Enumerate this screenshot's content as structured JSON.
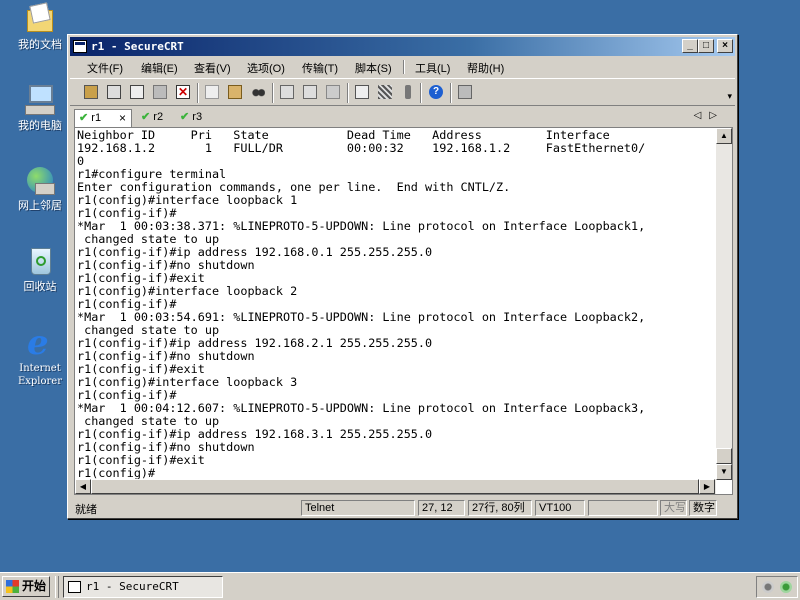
{
  "desktop": {
    "icons": [
      {
        "label": "我的文档",
        "icon": "my-documents-icon"
      },
      {
        "label": "我的电脑",
        "icon": "my-computer-icon"
      },
      {
        "label": "网上邻居",
        "icon": "network-places-icon"
      },
      {
        "label": "回收站",
        "icon": "recycle-bin-icon"
      },
      {
        "label": "Internet Explorer",
        "icon": "internet-explorer-icon"
      }
    ]
  },
  "window": {
    "title": "r1 - SecureCRT",
    "controls": {
      "minimize": "_",
      "maximize": "□",
      "close": "×"
    },
    "menu": [
      "文件(F)",
      "编辑(E)",
      "查看(V)",
      "选项(O)",
      "传输(T)",
      "脚本(S)",
      "工具(L)",
      "帮助(H)"
    ],
    "toolbar_icons": [
      "connect-icon",
      "quick-connect-icon",
      "connect-tab-icon",
      "reconnect-icon",
      "disconnect-icon",
      "copy-icon",
      "paste-icon",
      "find-icon",
      "print-setup-icon",
      "print-icon",
      "print-selection-icon",
      "session-options-icon",
      "global-options-icon",
      "keymap-icon",
      "help-icon",
      "about-icon"
    ],
    "tabs": [
      {
        "label": "r1",
        "active": true,
        "close": "×"
      },
      {
        "label": "r2",
        "active": false
      },
      {
        "label": "r3",
        "active": false
      }
    ],
    "tab_arrows": "◁▷",
    "terminal_lines": [
      "Neighbor ID     Pri   State           Dead Time   Address         Interface",
      "192.168.1.2       1   FULL/DR         00:00:32    192.168.1.2     FastEthernet0/",
      "0",
      "r1#configure terminal",
      "Enter configuration commands, one per line.  End with CNTL/Z.",
      "r1(config)#interface loopback 1",
      "r1(config-if)#",
      "*Mar  1 00:03:38.371: %LINEPROTO-5-UPDOWN: Line protocol on Interface Loopback1,",
      " changed state to up",
      "r1(config-if)#ip address 192.168.0.1 255.255.255.0",
      "r1(config-if)#no shutdown",
      "r1(config-if)#exit",
      "r1(config)#interface loopback 2",
      "r1(config-if)#",
      "*Mar  1 00:03:54.691: %LINEPROTO-5-UPDOWN: Line protocol on Interface Loopback2,",
      " changed state to up",
      "r1(config-if)#ip address 192.168.2.1 255.255.255.0",
      "r1(config-if)#no shutdown",
      "r1(config-if)#exit",
      "r1(config)#interface loopback 3",
      "r1(config-if)#",
      "*Mar  1 00:04:12.607: %LINEPROTO-5-UPDOWN: Line protocol on Interface Loopback3,",
      " changed state to up",
      "r1(config-if)#ip address 192.168.3.1 255.255.255.0",
      "r1(config-if)#no shutdown",
      "r1(config-if)#exit",
      "r1(config)#"
    ],
    "scroll_arrows": {
      "up": "▲",
      "down": "▼",
      "left": "◀",
      "right": "▶"
    },
    "status": {
      "ready": "就绪",
      "protocol": "Telnet",
      "cursor": "27, 12",
      "size": "27行, 80列",
      "emulation": "VT100",
      "blank": "",
      "caps": "大写",
      "num": "数字"
    }
  },
  "taskbar": {
    "start_label": "开始",
    "task_button": "r1 - SecureCRT"
  },
  "colors": {
    "desktop": "#3a6ea5",
    "title_start": "#0a246a",
    "title_end": "#a6caf0",
    "chrome": "#d4d0c8",
    "terminal_bg": "#ffffff",
    "tab_check": "#3bb33b"
  }
}
